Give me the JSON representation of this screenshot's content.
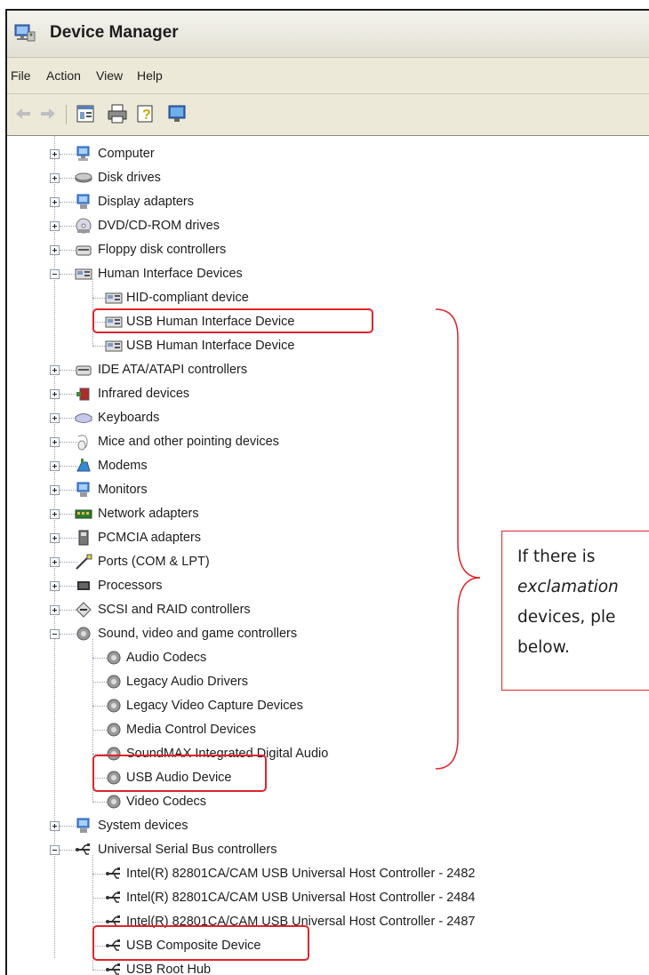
{
  "window": {
    "title": "Device Manager"
  },
  "menu": {
    "items": [
      "File",
      "Action",
      "View",
      "Help"
    ]
  },
  "toolbar": {
    "buttons": [
      "back-arrow-icon",
      "forward-arrow-icon",
      "properties-icon",
      "print-icon",
      "help-icon",
      "scan-hardware-icon"
    ]
  },
  "tree": {
    "items": [
      {
        "label": "Computer",
        "icon": "computer-icon",
        "level": 0,
        "expander": "plus"
      },
      {
        "label": "Disk drives",
        "icon": "disk-drive-icon",
        "level": 0,
        "expander": "plus"
      },
      {
        "label": "Display adapters",
        "icon": "display-adapter-icon",
        "level": 0,
        "expander": "plus"
      },
      {
        "label": "DVD/CD-ROM drives",
        "icon": "cd-drive-icon",
        "level": 0,
        "expander": "plus"
      },
      {
        "label": "Floppy disk controllers",
        "icon": "floppy-controller-icon",
        "level": 0,
        "expander": "plus"
      },
      {
        "label": "Human Interface Devices",
        "icon": "hid-icon",
        "level": 0,
        "expander": "minus"
      },
      {
        "label": "HID-compliant device",
        "icon": "hid-device-icon",
        "level": 1
      },
      {
        "label": "USB Human Interface Device",
        "icon": "hid-device-icon",
        "level": 1
      },
      {
        "label": "USB Human Interface Device",
        "icon": "hid-device-icon",
        "level": 1
      },
      {
        "label": "IDE ATA/ATAPI controllers",
        "icon": "ide-controller-icon",
        "level": 0,
        "expander": "plus"
      },
      {
        "label": "Infrared devices",
        "icon": "infrared-icon",
        "level": 0,
        "expander": "plus"
      },
      {
        "label": "Keyboards",
        "icon": "keyboard-icon",
        "level": 0,
        "expander": "plus"
      },
      {
        "label": "Mice and other pointing devices",
        "icon": "mouse-icon",
        "level": 0,
        "expander": "plus"
      },
      {
        "label": "Modems",
        "icon": "modem-icon",
        "level": 0,
        "expander": "plus"
      },
      {
        "label": "Monitors",
        "icon": "monitor-icon",
        "level": 0,
        "expander": "plus"
      },
      {
        "label": "Network adapters",
        "icon": "network-adapter-icon",
        "level": 0,
        "expander": "plus"
      },
      {
        "label": "PCMCIA adapters",
        "icon": "pcmcia-icon",
        "level": 0,
        "expander": "plus"
      },
      {
        "label": "Ports (COM & LPT)",
        "icon": "port-icon",
        "level": 0,
        "expander": "plus"
      },
      {
        "label": "Processors",
        "icon": "processor-icon",
        "level": 0,
        "expander": "plus"
      },
      {
        "label": "SCSI and RAID controllers",
        "icon": "scsi-icon",
        "level": 0,
        "expander": "plus"
      },
      {
        "label": "Sound, video and game controllers",
        "icon": "sound-icon",
        "level": 0,
        "expander": "minus"
      },
      {
        "label": "Audio Codecs",
        "icon": "sound-device-icon",
        "level": 1
      },
      {
        "label": "Legacy Audio Drivers",
        "icon": "sound-device-icon",
        "level": 1
      },
      {
        "label": "Legacy Video Capture Devices",
        "icon": "sound-device-icon",
        "level": 1
      },
      {
        "label": "Media Control Devices",
        "icon": "sound-device-icon",
        "level": 1
      },
      {
        "label": "SoundMAX Integrated Digital Audio",
        "icon": "sound-device-icon",
        "level": 1
      },
      {
        "label": "USB Audio Device",
        "icon": "sound-device-icon",
        "level": 1
      },
      {
        "label": "Video Codecs",
        "icon": "sound-device-icon",
        "level": 1
      },
      {
        "label": "System devices",
        "icon": "system-device-icon",
        "level": 0,
        "expander": "plus"
      },
      {
        "label": "Universal Serial Bus controllers",
        "icon": "usb-icon",
        "level": 0,
        "expander": "minus"
      },
      {
        "label": "Intel(R) 82801CA/CAM USB Universal Host Controller - 2482",
        "icon": "usb-device-icon",
        "level": 1
      },
      {
        "label": "Intel(R) 82801CA/CAM USB Universal Host Controller - 2484",
        "icon": "usb-device-icon",
        "level": 1
      },
      {
        "label": "Intel(R) 82801CA/CAM USB Universal Host Controller - 2487",
        "icon": "usb-device-icon",
        "level": 1
      },
      {
        "label": "USB Composite Device",
        "icon": "usb-device-icon",
        "level": 1
      },
      {
        "label": "USB Root Hub",
        "icon": "usb-device-icon",
        "level": 1
      }
    ]
  },
  "annotation": {
    "highlight_color": "#e0242b",
    "callout_lines": [
      {
        "text": "If there is"
      },
      {
        "text": "exclamation",
        "style": "italic"
      },
      {
        "text": "devices, ple"
      },
      {
        "text": "below."
      }
    ]
  }
}
